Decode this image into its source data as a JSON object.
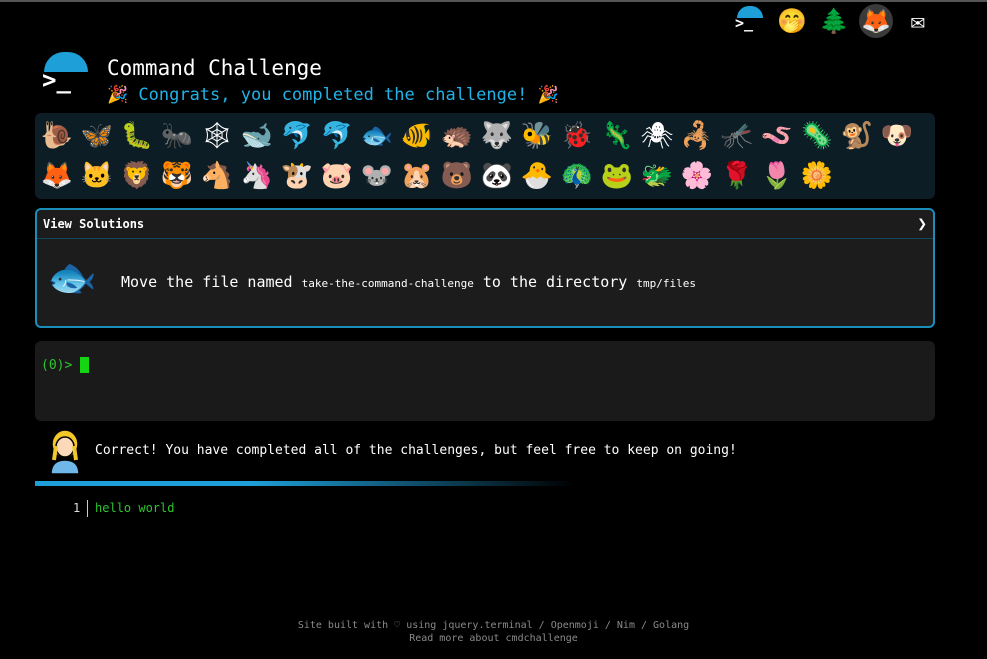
{
  "header": {
    "title": "Command Challenge",
    "subtitle": "🎉 Congrats, you completed the challenge! 🎉",
    "logo_glyph": ">_"
  },
  "top_icons": [
    {
      "name": "terminal-logo-icon",
      "glyph": ">_"
    },
    {
      "name": "shushing-face-icon",
      "glyph": "🤭"
    },
    {
      "name": "evergreen-tree-icon",
      "glyph": "🌲"
    },
    {
      "name": "gitlab-icon",
      "glyph": "🦊"
    },
    {
      "name": "envelope-icon",
      "glyph": "✉"
    }
  ],
  "animals": [
    "🐌",
    "🦋",
    "🐛",
    "🐜",
    "🕸",
    "🐋",
    "🐬",
    "🐬",
    "🐟",
    "🐠",
    "🦔",
    "🐺",
    "🐝",
    "🐞",
    "🦎",
    "🕷",
    "🦂",
    "🦟",
    "🪱",
    "🦠",
    "🐒",
    "🐶",
    "🦊",
    "🐱",
    "🦁",
    "🐯",
    "🐴",
    "🦄",
    "🐮",
    "🐷",
    "🐭",
    "🐹",
    "🐻",
    "🐼",
    "🐣",
    "🦚",
    "🐸",
    "🐲",
    "🌸",
    "🌹",
    "🌷",
    "🌼"
  ],
  "solutions": {
    "header": "View Solutions",
    "chevron": "❯",
    "fish_glyph": "🐟",
    "task_prefix": "Move the file named ",
    "task_file": "take-the-command-challenge",
    "task_middle": " to the directory ",
    "task_dir": "tmp/files"
  },
  "terminal": {
    "prompt": "(0)>"
  },
  "result": {
    "person_glyph": "👩",
    "text": "Correct! You have completed all of the challenges, but feel free to keep on going!"
  },
  "output": {
    "line_number": "1",
    "text": "hello world"
  },
  "footer": {
    "line1": "Site built with ♡ using jquery.terminal / Openmoji / Nim / Golang",
    "line2": "Read more about cmdchallenge"
  }
}
